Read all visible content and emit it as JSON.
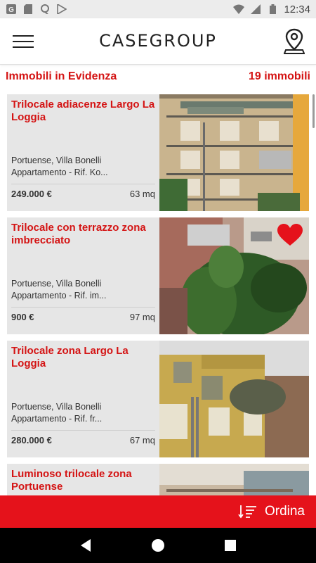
{
  "status_bar": {
    "icons": [
      "google-icon",
      "sd-card-icon",
      "maps-icon",
      "play-store-icon",
      "wifi-icon",
      "signal-icon",
      "battery-icon"
    ],
    "time": "12:34"
  },
  "app_bar": {
    "brand": "CASEGROUP",
    "menu_icon": "hamburger-menu-icon",
    "location_icon": "map-pin-icon"
  },
  "section": {
    "title": "Immobili in Evidenza",
    "count": "19 immobili"
  },
  "listings": [
    {
      "title": "Trilocale adiacenze Largo La Loggia",
      "location": "Portuense, Villa Bonelli",
      "description": "Appartamento - Rif. Ko...",
      "price": "249.000 €",
      "size": "63 mq",
      "favorite": false
    },
    {
      "title": "Trilocale con terrazzo zona imbrecciato",
      "location": "Portuense, Villa Bonelli",
      "description": "Appartamento - Rif. im...",
      "price": "900 €",
      "size": "97 mq",
      "favorite": true
    },
    {
      "title": "Trilocale zona Largo La Loggia",
      "location": "Portuense, Villa Bonelli",
      "description": "Appartamento - Rif. fr...",
      "price": "280.000 €",
      "size": "67 mq",
      "favorite": false
    },
    {
      "title": "Luminoso trilocale zona Portuense",
      "location": "",
      "description": "",
      "price": "",
      "size": "",
      "favorite": false
    }
  ],
  "sort_bar": {
    "label": "Ordina",
    "icon": "sort-icon"
  },
  "colors": {
    "accent": "#e5121b",
    "title_red": "#d41414"
  }
}
